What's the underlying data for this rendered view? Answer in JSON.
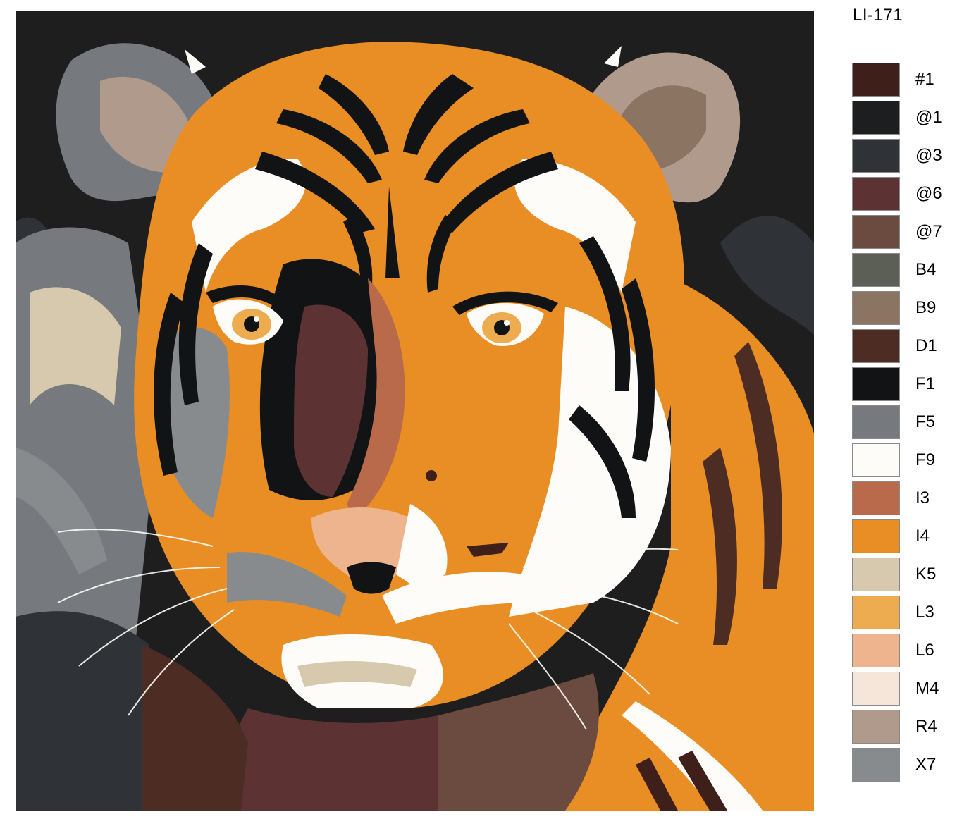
{
  "product_code": "LI-171",
  "artwork": {
    "icon": "tiger-portrait-illustration"
  },
  "palette": [
    {
      "code": "#1",
      "color": "#3f1f1a"
    },
    {
      "code": "@1",
      "color": "#1d1e20"
    },
    {
      "code": "@3",
      "color": "#2f3337"
    },
    {
      "code": "@6",
      "color": "#5c3332"
    },
    {
      "code": "@7",
      "color": "#6b4a40"
    },
    {
      "code": "B4",
      "color": "#5b5f55"
    },
    {
      "code": "B9",
      "color": "#8b7461"
    },
    {
      "code": "D1",
      "color": "#4d2c24"
    },
    {
      "code": "F1",
      "color": "#121315"
    },
    {
      "code": "F5",
      "color": "#767a7e"
    },
    {
      "code": "F9",
      "color": "#fdfcf8"
    },
    {
      "code": "I3",
      "color": "#b96a4a"
    },
    {
      "code": "I4",
      "color": "#e88e25"
    },
    {
      "code": "K5",
      "color": "#d7c9ad"
    },
    {
      "code": "L3",
      "color": "#edac4f"
    },
    {
      "code": "L6",
      "color": "#edb48d"
    },
    {
      "code": "M4",
      "color": "#f6e6d9"
    },
    {
      "code": "R4",
      "color": "#b09a8c"
    },
    {
      "code": "X7",
      "color": "#888b8d"
    }
  ]
}
